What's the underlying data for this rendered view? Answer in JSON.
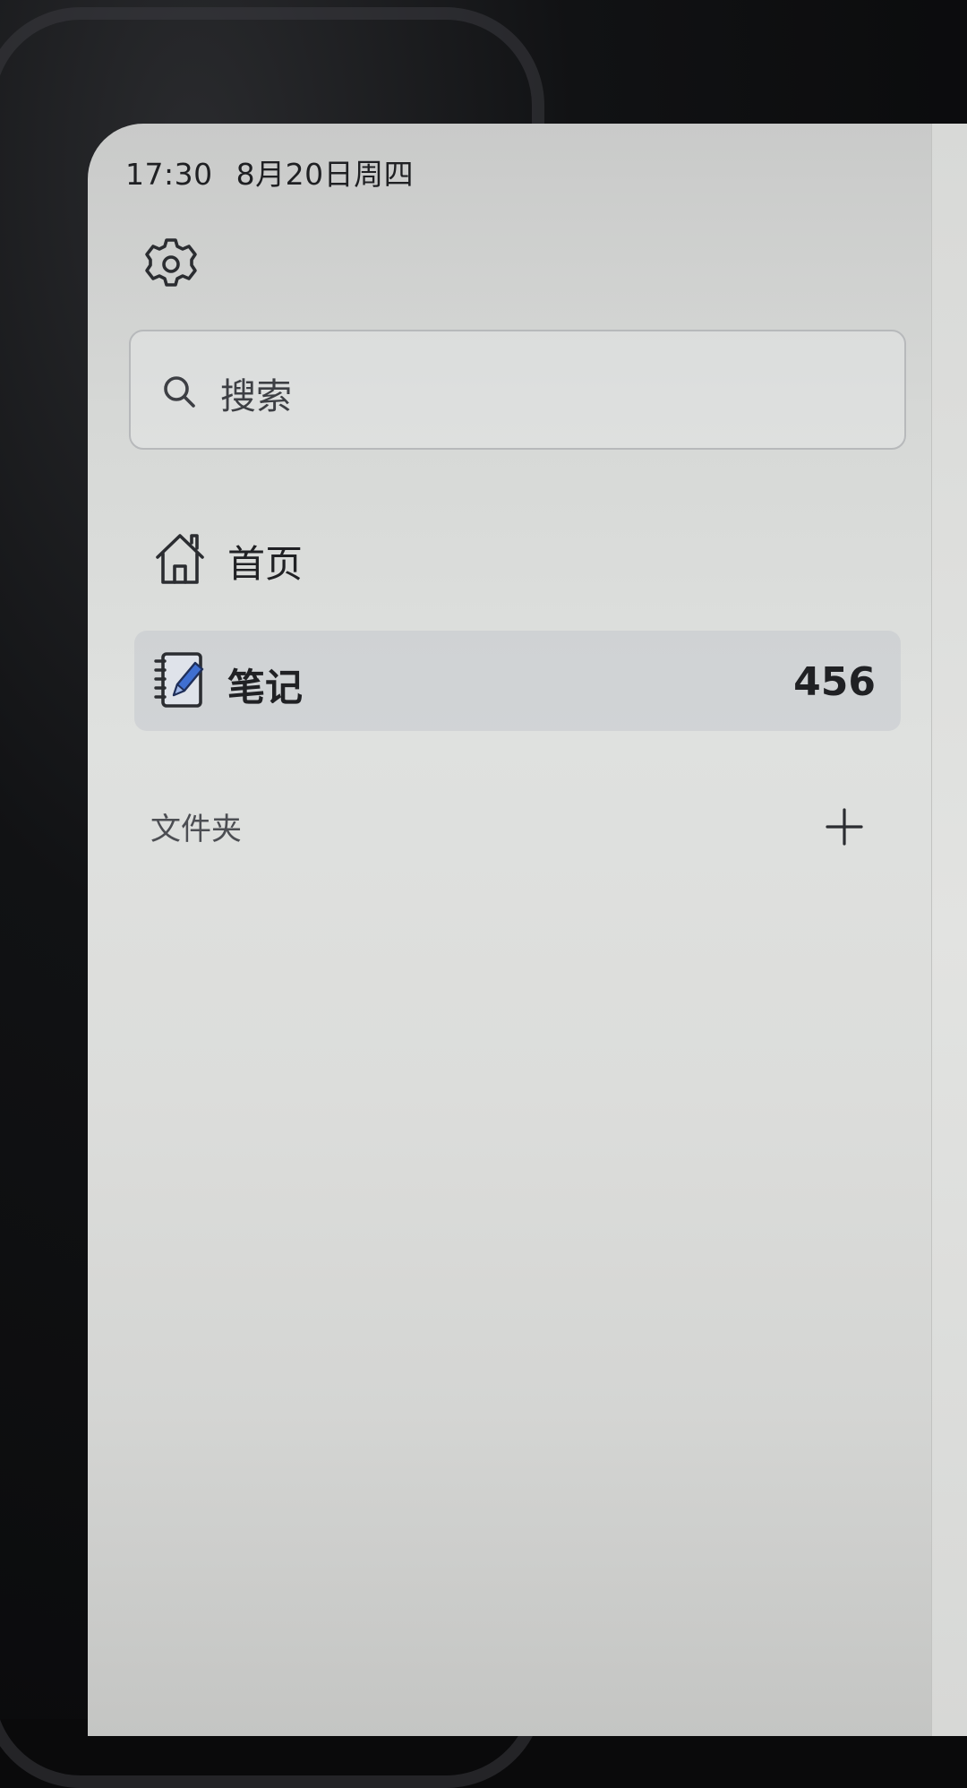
{
  "status_bar": {
    "time": "17:30",
    "date": "8月20日周四"
  },
  "search": {
    "placeholder": "搜索"
  },
  "nav": {
    "items": [
      {
        "label": "首页",
        "icon": "house-icon"
      },
      {
        "label": "笔记",
        "icon": "notebook-pen-icon",
        "count": "456",
        "selected": true
      }
    ]
  },
  "folders": {
    "header": "文件夹",
    "add_icon": "plus-icon"
  },
  "colors": {
    "accent": "#3f6fd1",
    "sidebar_bg": "#dcdedc",
    "selected_bg": "#c4c9cd"
  }
}
